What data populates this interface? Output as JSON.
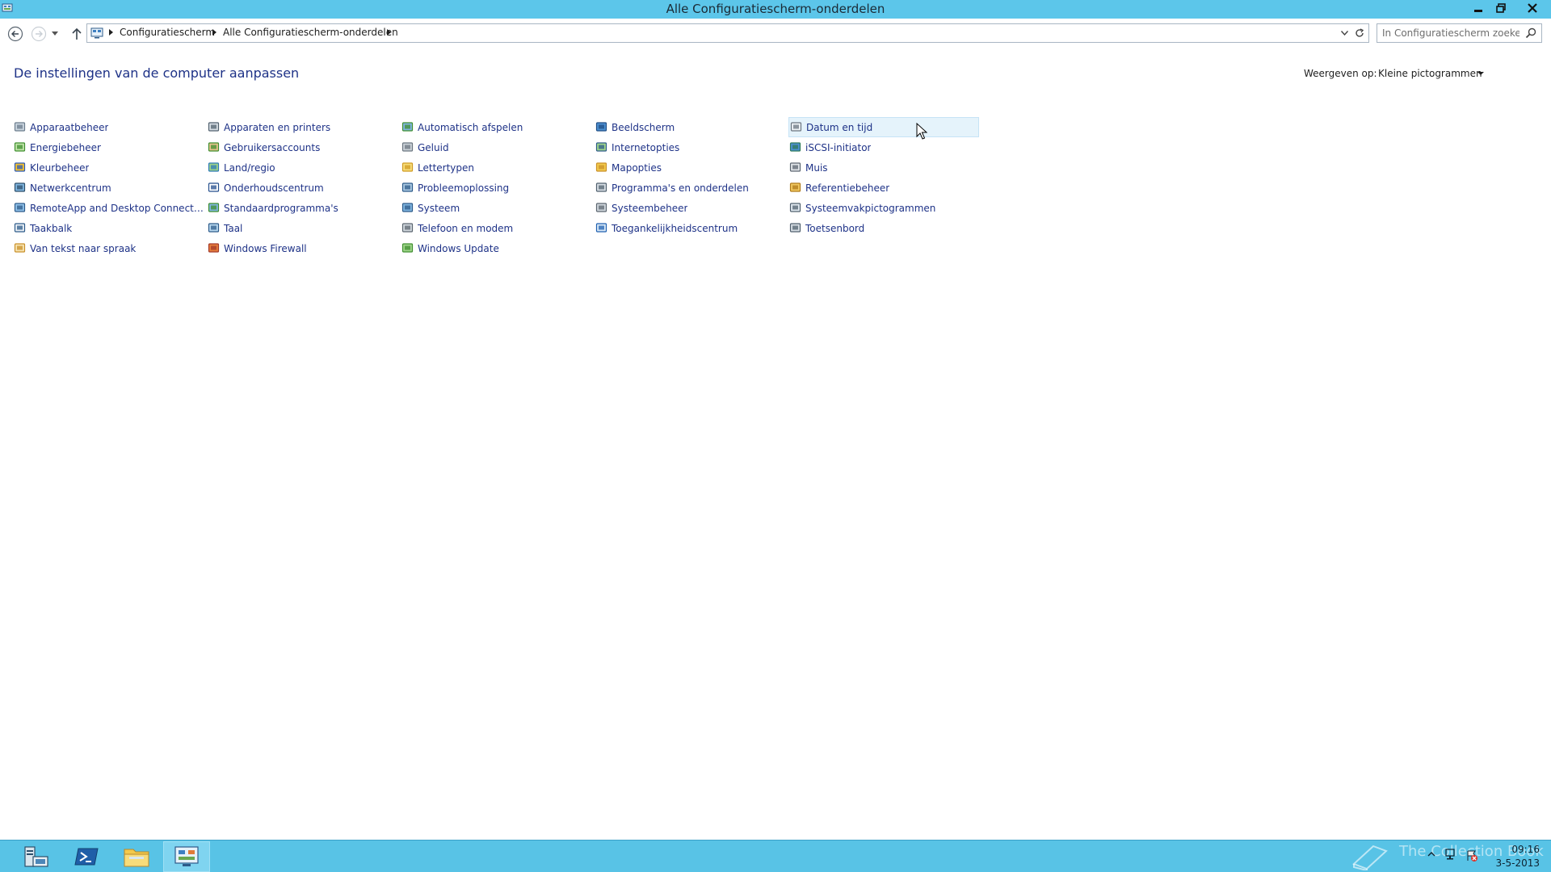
{
  "window": {
    "title": "Alle Configuratiescherm-onderdelen"
  },
  "address": {
    "crumbs": [
      "Configuratiescherm",
      "Alle Configuratiescherm-onderdelen"
    ],
    "search_placeholder": "In Configuratiescherm zoeken"
  },
  "header": {
    "heading": "De instellingen van de computer aanpassen",
    "view_by_label": "Weergeven op:",
    "view_by_value": "Kleine pictogrammen"
  },
  "columns": [
    [
      {
        "label": "Apparaatbeheer",
        "icon": "device-manager-icon"
      },
      {
        "label": "Energiebeheer",
        "icon": "power-options-icon"
      },
      {
        "label": "Kleurbeheer",
        "icon": "color-management-icon"
      },
      {
        "label": "Netwerkcentrum",
        "icon": "network-center-icon"
      },
      {
        "label": "RemoteApp and Desktop Connections",
        "icon": "remoteapp-icon"
      },
      {
        "label": "Taakbalk",
        "icon": "taskbar-icon"
      },
      {
        "label": "Van tekst naar spraak",
        "icon": "text-to-speech-icon"
      }
    ],
    [
      {
        "label": "Apparaten en printers",
        "icon": "devices-printers-icon"
      },
      {
        "label": "Gebruikersaccounts",
        "icon": "user-accounts-icon"
      },
      {
        "label": "Land/regio",
        "icon": "region-icon"
      },
      {
        "label": "Onderhoudscentrum",
        "icon": "action-center-flag-icon"
      },
      {
        "label": "Standaardprogramma's",
        "icon": "default-programs-icon"
      },
      {
        "label": "Taal",
        "icon": "language-icon"
      },
      {
        "label": "Windows Firewall",
        "icon": "firewall-icon"
      }
    ],
    [
      {
        "label": "Automatisch afspelen",
        "icon": "autoplay-icon"
      },
      {
        "label": "Geluid",
        "icon": "sound-icon"
      },
      {
        "label": "Lettertypen",
        "icon": "fonts-icon"
      },
      {
        "label": "Probleemoplossing",
        "icon": "troubleshooting-icon"
      },
      {
        "label": "Systeem",
        "icon": "system-icon"
      },
      {
        "label": "Telefoon en modem",
        "icon": "phone-modem-icon"
      },
      {
        "label": "Windows Update",
        "icon": "windows-update-icon"
      }
    ],
    [
      {
        "label": "Beeldscherm",
        "icon": "display-icon"
      },
      {
        "label": "Internetopties",
        "icon": "internet-options-icon"
      },
      {
        "label": "Mapopties",
        "icon": "folder-options-icon"
      },
      {
        "label": "Programma's en onderdelen",
        "icon": "programs-features-icon"
      },
      {
        "label": "Systeembeheer",
        "icon": "admin-tools-icon"
      },
      {
        "label": "Toegankelijkheidscentrum",
        "icon": "ease-of-access-icon"
      }
    ],
    [
      {
        "label": "Datum en tijd",
        "icon": "date-time-icon",
        "hover": true
      },
      {
        "label": "iSCSI-initiator",
        "icon": "iscsi-icon"
      },
      {
        "label": "Muis",
        "icon": "mouse-icon"
      },
      {
        "label": "Referentiebeheer",
        "icon": "credential-manager-icon"
      },
      {
        "label": "Systeemvakpictogrammen",
        "icon": "notification-area-icon"
      },
      {
        "label": "Toetsenbord",
        "icon": "keyboard-icon"
      }
    ]
  ],
  "taskbar": {
    "time": "09:16",
    "date": "3-5-2013",
    "watermark": "The Collection Book"
  },
  "colors": {
    "titlebar": "#5cc6ea",
    "taskbar": "#58c3e6",
    "link": "#1e3287"
  }
}
